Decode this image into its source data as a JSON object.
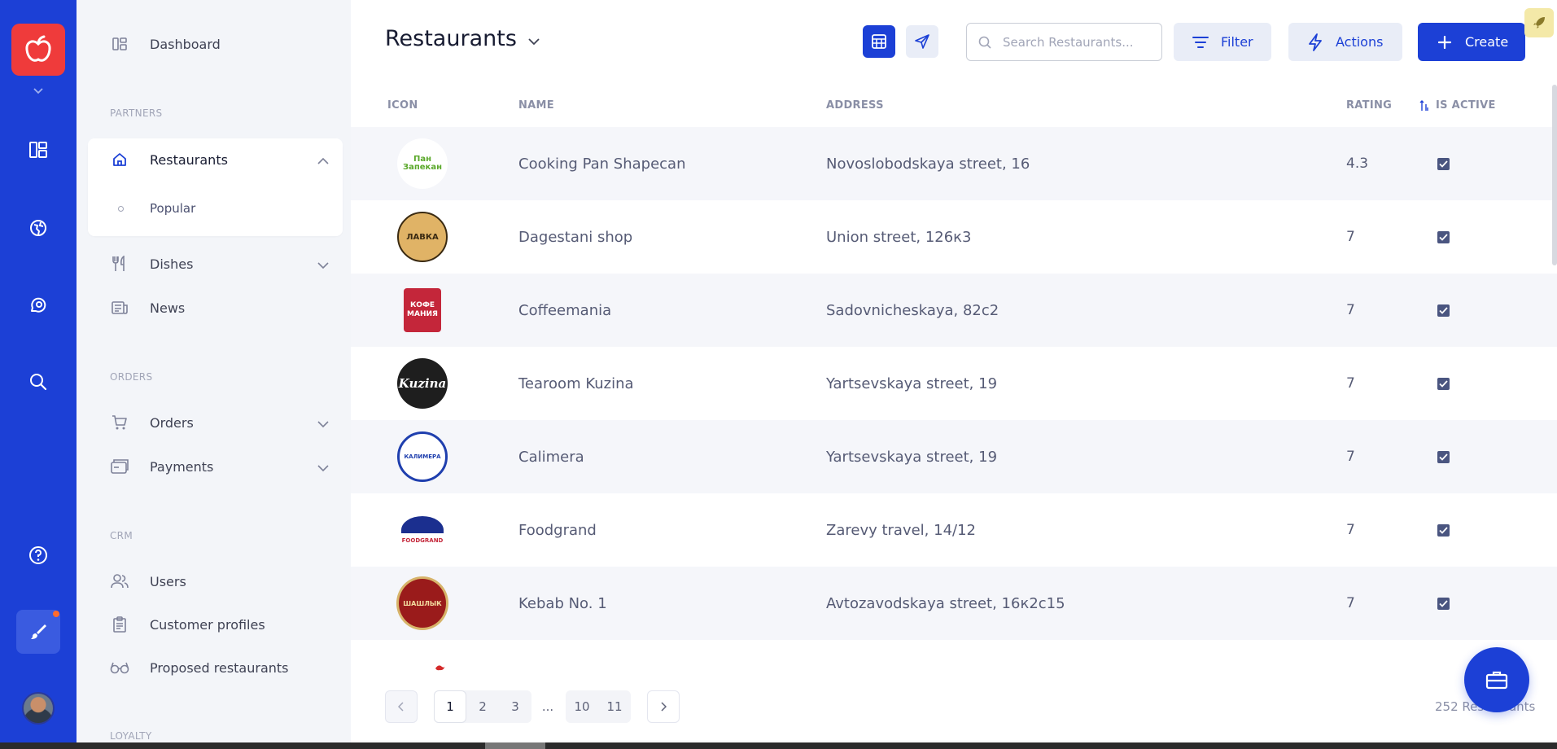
{
  "colors": {
    "brand": "#1c40d6",
    "logo_bg": "#ef3b3b",
    "sidebar_bg": "#f3f5f9",
    "row_alt": "#f5f6fa"
  },
  "rail": {
    "icons": [
      "dashboard-icon",
      "globe-icon",
      "chat-icon",
      "search-icon",
      "help-icon",
      "brush-icon"
    ]
  },
  "sidebar": {
    "dashboard": "Dashboard",
    "sections": {
      "partners": "PARTNERS",
      "orders": "ORDERS",
      "crm": "CRM",
      "loyalty": "LOYALTY"
    },
    "items": {
      "restaurants": "Restaurants",
      "popular": "Popular",
      "dishes": "Dishes",
      "news": "News",
      "orders": "Orders",
      "payments": "Payments",
      "users": "Users",
      "customer_profiles": "Customer profiles",
      "proposed_restaurants": "Proposed restaurants"
    }
  },
  "header": {
    "title": "Restaurants",
    "search_placeholder": "Search Restaurants...",
    "filter_label": "Filter",
    "actions_label": "Actions",
    "create_label": "Create"
  },
  "table": {
    "columns": {
      "icon": "ICON",
      "name": "NAME",
      "address": "ADDRESS",
      "rating": "RATING",
      "is_active": "IS ACTIVE"
    },
    "rows": [
      {
        "name": "Cooking Pan Shapecan",
        "address": "Novoslobodskaya street, 16",
        "rating": "4.3",
        "active": true,
        "logo_text": "Пан Запекан"
      },
      {
        "name": "Dagestani shop",
        "address": "Union street, 126к3",
        "rating": "7",
        "active": true,
        "logo_text": "ЛАВКА"
      },
      {
        "name": "Coffeemania",
        "address": "Sadovnicheskaya, 82с2",
        "rating": "7",
        "active": true,
        "logo_text": "КОФЕ МАНИЯ"
      },
      {
        "name": "Tearoom Kuzina",
        "address": "Yartsevskaya street, 19",
        "rating": "7",
        "active": true,
        "logo_text": "Kuzina"
      },
      {
        "name": "Calimera",
        "address": "Yartsevskaya street, 19",
        "rating": "7",
        "active": true,
        "logo_text": "КАЛИМЕРА"
      },
      {
        "name": "Foodgrand",
        "address": "Zarevy travel, 14/12",
        "rating": "7",
        "active": true,
        "logo_text": "FOODGRAND"
      },
      {
        "name": "Kebab No. 1",
        "address": "Avtozavodskaya street, 16к2с15",
        "rating": "7",
        "active": true,
        "logo_text": "ШАШЛЫК"
      }
    ]
  },
  "pagination": {
    "pages_a": [
      "1",
      "2",
      "3"
    ],
    "ellipsis": "...",
    "pages_b": [
      "10",
      "11"
    ],
    "current": "1",
    "total_label": "252 Restaurants"
  }
}
